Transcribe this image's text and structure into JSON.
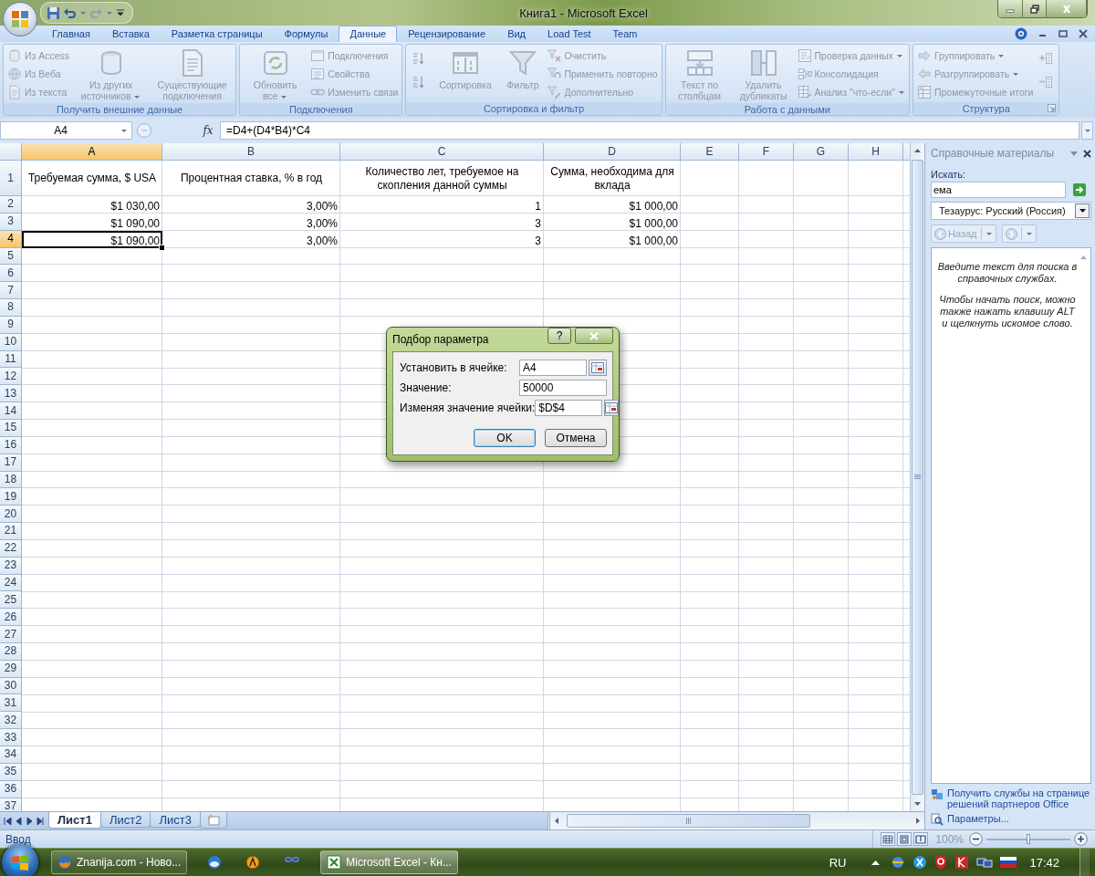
{
  "window": {
    "title": "Книга1 - Microsoft Excel"
  },
  "ribbon_tabs": [
    {
      "label": "Главная",
      "selected": false
    },
    {
      "label": "Вставка",
      "selected": false
    },
    {
      "label": "Разметка страницы",
      "selected": false
    },
    {
      "label": "Формулы",
      "selected": false
    },
    {
      "label": "Данные",
      "selected": true
    },
    {
      "label": "Рецензирование",
      "selected": false
    },
    {
      "label": "Вид",
      "selected": false
    },
    {
      "label": "Load Test",
      "selected": false
    },
    {
      "label": "Team",
      "selected": false
    }
  ],
  "ribbon_groups": [
    {
      "label": "Получить внешние данные",
      "commands": [
        {
          "kind": "small",
          "label": "Из Access",
          "disabled": true
        },
        {
          "kind": "small",
          "label": "Из Веба",
          "disabled": true
        },
        {
          "kind": "small",
          "label": "Из текста",
          "disabled": true
        },
        {
          "kind": "large",
          "label": "Из других источников",
          "dropdown": true,
          "disabled": true
        },
        {
          "kind": "large",
          "label": "Существующие подключения",
          "disabled": true
        }
      ]
    },
    {
      "label": "Подключения",
      "commands": [
        {
          "kind": "large",
          "label": "Обновить все",
          "dropdown": true,
          "disabled": true
        },
        {
          "kind": "small",
          "label": "Подключения",
          "disabled": true
        },
        {
          "kind": "small",
          "label": "Свойства",
          "disabled": true
        },
        {
          "kind": "small",
          "label": "Изменить связи",
          "disabled": true
        }
      ]
    },
    {
      "label": "Сортировка и фильтр",
      "commands": [
        {
          "kind": "icon",
          "disabled": true
        },
        {
          "kind": "icon",
          "disabled": true
        },
        {
          "kind": "large",
          "label": "Сортировка",
          "disabled": true
        },
        {
          "kind": "large",
          "label": "Фильтр",
          "disabled": true
        },
        {
          "kind": "small",
          "label": "Очистить",
          "disabled": true
        },
        {
          "kind": "small",
          "label": "Применить повторно",
          "disabled": true
        },
        {
          "kind": "small",
          "label": "Дополнительно",
          "disabled": true
        }
      ]
    },
    {
      "label": "Работа с данными",
      "commands": [
        {
          "kind": "large",
          "label": "Текст по столбцам",
          "disabled": true
        },
        {
          "kind": "large",
          "label": "Удалить дубликаты",
          "disabled": true
        },
        {
          "kind": "small",
          "label": "Проверка данных",
          "dropdown": true,
          "disabled": true
        },
        {
          "kind": "small",
          "label": "Консолидация",
          "disabled": true
        },
        {
          "kind": "small",
          "label": "Анализ \"что-если\"",
          "dropdown": true,
          "disabled": true
        }
      ]
    },
    {
      "label": "Структура",
      "launcher": true,
      "commands": [
        {
          "kind": "small",
          "label": "Группировать",
          "dropdown": true,
          "disabled": true
        },
        {
          "kind": "small",
          "label": "Разгруппировать",
          "dropdown": true,
          "disabled": true
        },
        {
          "kind": "small",
          "label": "Промежуточные итоги",
          "disabled": true
        },
        {
          "kind": "icon",
          "disabled": true
        },
        {
          "kind": "icon",
          "disabled": true
        }
      ]
    }
  ],
  "formula_bar": {
    "name_box": "A4",
    "function_button": "fx",
    "formula": "=D4+(D4*B4)*C4"
  },
  "columns": [
    {
      "label": "A",
      "selected": true
    },
    {
      "label": "B",
      "selected": false
    },
    {
      "label": "C",
      "selected": false
    },
    {
      "label": "D",
      "selected": false
    },
    {
      "label": "E",
      "selected": false
    },
    {
      "label": "F",
      "selected": false
    },
    {
      "label": "G",
      "selected": false
    },
    {
      "label": "H",
      "selected": false
    }
  ],
  "rows": [
    {
      "header": "1",
      "selected": false,
      "kind": "heading",
      "cells": [
        {
          "text": "Требуемая сумма, $ USA",
          "selected": false
        },
        {
          "text": "Процентная ставка, % в год",
          "selected": false
        },
        {
          "text": "Количество лет, требуемое на скопления данной суммы",
          "selected": false
        },
        {
          "text": "Сумма, необходима для вклада",
          "selected": false
        }
      ]
    },
    {
      "header": "2",
      "selected": false,
      "kind": "data",
      "cells": [
        {
          "text": "$1 030,00",
          "selected": false
        },
        {
          "text": "3,00%",
          "selected": false
        },
        {
          "text": "1",
          "selected": false
        },
        {
          "text": "$1 000,00",
          "selected": false
        }
      ]
    },
    {
      "header": "3",
      "selected": false,
      "kind": "data",
      "cells": [
        {
          "text": "$1 090,00",
          "selected": false
        },
        {
          "text": "3,00%",
          "selected": false
        },
        {
          "text": "3",
          "selected": false
        },
        {
          "text": "$1 000,00",
          "selected": false
        }
      ]
    },
    {
      "header": "4",
      "selected": true,
      "kind": "data",
      "cells": [
        {
          "text": "$1 090,00",
          "selected": true
        },
        {
          "text": "3,00%",
          "selected": false
        },
        {
          "text": "3",
          "selected": false
        },
        {
          "text": "$1 000,00",
          "selected": false
        }
      ]
    },
    {
      "header": "5",
      "selected": false
    },
    {
      "header": "6",
      "selected": false
    },
    {
      "header": "7",
      "selected": false
    },
    {
      "header": "8",
      "selected": false
    },
    {
      "header": "9",
      "selected": false
    },
    {
      "header": "10",
      "selected": false
    },
    {
      "header": "11",
      "selected": false
    },
    {
      "header": "12",
      "selected": false
    },
    {
      "header": "13",
      "selected": false
    },
    {
      "header": "14",
      "selected": false
    },
    {
      "header": "15",
      "selected": false
    },
    {
      "header": "16",
      "selected": false
    },
    {
      "header": "17",
      "selected": false
    },
    {
      "header": "18",
      "selected": false
    },
    {
      "header": "19",
      "selected": false
    },
    {
      "header": "20",
      "selected": false
    },
    {
      "header": "21",
      "selected": false
    },
    {
      "header": "22",
      "selected": false
    },
    {
      "header": "23",
      "selected": false
    },
    {
      "header": "24",
      "selected": false
    },
    {
      "header": "25",
      "selected": false
    },
    {
      "header": "26",
      "selected": false
    },
    {
      "header": "27",
      "selected": false
    },
    {
      "header": "28",
      "selected": false
    },
    {
      "header": "29",
      "selected": false
    },
    {
      "header": "30",
      "selected": false
    },
    {
      "header": "31",
      "selected": false
    },
    {
      "header": "32",
      "selected": false
    },
    {
      "header": "33",
      "selected": false
    },
    {
      "header": "34",
      "selected": false
    },
    {
      "header": "35",
      "selected": false
    },
    {
      "header": "36",
      "selected": false
    },
    {
      "header": "37",
      "selected": false
    }
  ],
  "dialog": {
    "title": "Подбор параметра",
    "help_button": "?",
    "fields": [
      {
        "label": "Установить в ячейке:",
        "value": "A4",
        "ref_button": true
      },
      {
        "label": "Значение:",
        "value": "50000"
      },
      {
        "label": "Изменяя значение ячейки:",
        "value": "$D$4",
        "ref_button": true
      }
    ],
    "buttons": [
      {
        "label": "OK",
        "default": true
      },
      {
        "label": "Отмена",
        "default": false
      }
    ]
  },
  "sheet_tabs": [
    {
      "label": "Лист1",
      "selected": true
    },
    {
      "label": "Лист2",
      "selected": false
    },
    {
      "label": "Лист3",
      "selected": false
    }
  ],
  "research": {
    "title": "Справочные материалы",
    "search_label": "Искать:",
    "search_value": "ема",
    "source": "Тезаурус: Русский (Россия)",
    "back_button": {
      "label": "Назад",
      "disabled": true
    },
    "messages": [
      "Введите текст для поиска в справочных службах.",
      "Чтобы начать поиск, можно также нажать клавишу ALT и щелкнуть искомое слово."
    ],
    "links": [
      "Получить службы на странице решений партнеров Office",
      "Параметры..."
    ]
  },
  "status_bar": {
    "mode": "Ввод",
    "zoom": "100%",
    "zoom_slider": {
      "level": 0.5
    }
  },
  "taskbar": {
    "tasks": [
      {
        "label": "Znanija.com - Ново...",
        "selected": false
      },
      {
        "label": "Microsoft Excel - Кн...",
        "selected": true
      }
    ],
    "language": "RU",
    "clock": "17:42"
  }
}
